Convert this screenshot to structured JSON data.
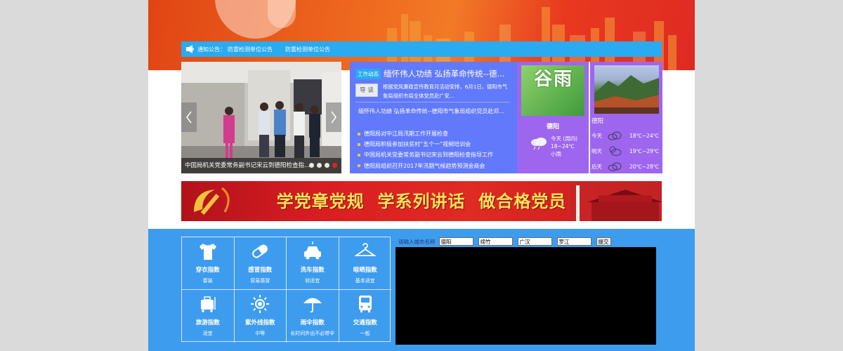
{
  "notice": {
    "label": "通知公告：",
    "links": [
      "防雷检测单位公告",
      "防雷检测单位公告"
    ]
  },
  "carousel": {
    "caption": "中国局机关党委常务副书记宋云到德阳检查指...",
    "dot_count": 4,
    "active_dot": 4
  },
  "news": {
    "badge": "工作动态",
    "headline": "缅怀伟人功绩 弘扬革命传统--德...",
    "read_button": "导 读",
    "summary": "根据党风廉政宣传教育月活动安排，6月1日，德阳市气象局组织市局全体党员赴广安...",
    "feature": "缅怀伟人功绩  弘扬革命传统--德阳市气象局组织党员赴邓...",
    "items": [
      "德阳局对中江局汛期工作开展检查",
      "德阳局积极参加扶贫村“五个一”视频培训会",
      "中国局机关党委常务副书记宋云到德阳检查指导工作",
      "德阳局组织召开2017年汛期气候趋势预测会商会"
    ]
  },
  "weather": {
    "solar_term": "谷雨",
    "city_left": "德阳",
    "today_lines": [
      "今天 (周四)",
      "18~24℃",
      "小雨"
    ],
    "city_right": "德阳",
    "forecast": [
      {
        "day": "今天",
        "temp": "18℃~24℃",
        "icon": "cloudy-icon"
      },
      {
        "day": "明天",
        "temp": "19℃~29℃",
        "icon": "partly-cloudy-icon"
      },
      {
        "day": "后天",
        "temp": "20℃~28℃",
        "icon": "cloudy-icon"
      }
    ]
  },
  "banner": {
    "slogan": "学党章党规  学系列讲话  做合格党员"
  },
  "indices": [
    {
      "name": "穿衣指数",
      "value": "春装",
      "icon": "tshirt-icon"
    },
    {
      "name": "感冒指数",
      "value": "容易感冒",
      "icon": "pill-icon"
    },
    {
      "name": "洗车指数",
      "value": "较适宜",
      "icon": "car-wash-icon"
    },
    {
      "name": "晾晒指数",
      "value": "基本适宜",
      "icon": "hanger-icon"
    },
    {
      "name": "旅游指数",
      "value": "适宜",
      "icon": "luggage-icon"
    },
    {
      "name": "紫外线指数",
      "value": "中等",
      "icon": "sun-icon"
    },
    {
      "name": "雨伞指数",
      "value": "长时间外出不必带伞",
      "icon": "umbrella-icon"
    },
    {
      "name": "交通指数",
      "value": "一般",
      "icon": "bus-icon"
    }
  ],
  "city_form": {
    "label": "请输入城市名称",
    "inputs": [
      "德阳",
      "绵竹",
      "广汉",
      "罗江"
    ],
    "submit": "提交"
  },
  "colors": {
    "notice_bar": "#29aaf1",
    "news_panel": "#6179fb",
    "weather_panel": "#9e66ee",
    "blue_section": "#3e9cef",
    "active_dot": "#e22121"
  }
}
